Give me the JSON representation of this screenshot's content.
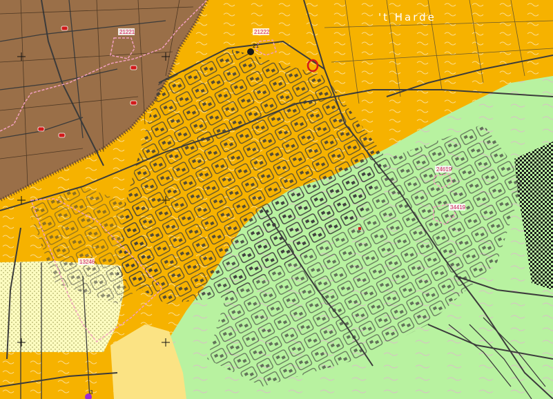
{
  "map": {
    "place_name": "'t Harde",
    "labels": {
      "a": "21221",
      "b": "21222",
      "c": "21",
      "d": "24619",
      "e": "34419",
      "f": "13246",
      "g": "3"
    },
    "colors": {
      "brown_zone": "#9a6f48",
      "orange_zone": "#f6b200",
      "green_zone": "#b8f2a0",
      "pale_yellow_zone": "#fdfcc0",
      "sand_zone": "#fbe384",
      "streets": "#3b3b3b",
      "boundary": "#f2a0c0",
      "marker_red": "#d11a1a"
    }
  }
}
